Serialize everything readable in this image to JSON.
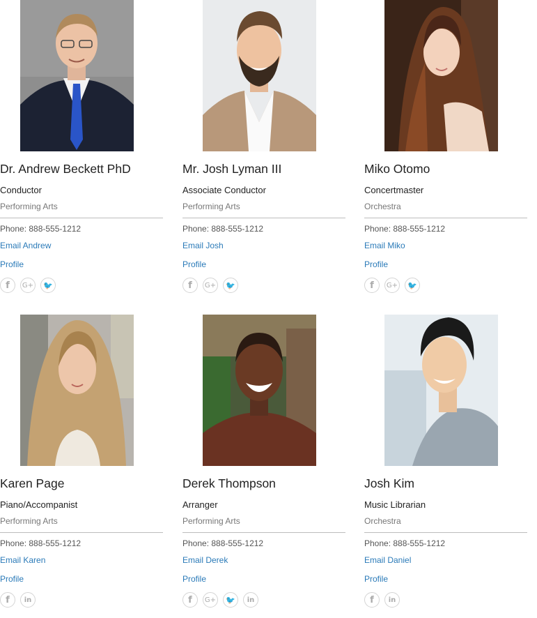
{
  "people": [
    {
      "name": "Dr. Andrew Beckett PhD",
      "title": "Conductor",
      "department": "Performing Arts",
      "phone": "Phone: 888-555-1212",
      "email_label": "Email Andrew",
      "profile_label": "Profile"
    },
    {
      "name": "Mr. Josh Lyman III",
      "title": "Associate Conductor",
      "department": "Performing Arts",
      "phone": "Phone: 888-555-1212",
      "email_label": "Email Josh",
      "profile_label": "Profile"
    },
    {
      "name": "Miko Otomo",
      "title": "Concertmaster",
      "department": "Orchestra",
      "phone": "Phone: 888-555-1212",
      "email_label": "Email Miko",
      "profile_label": "Profile"
    },
    {
      "name": "Karen Page",
      "title": "Piano/Accompanist",
      "department": "Performing Arts",
      "phone": "Phone: 888-555-1212",
      "email_label": "Email Karen",
      "profile_label": "Profile"
    },
    {
      "name": "Derek Thompson",
      "title": "Arranger",
      "department": "Performing Arts",
      "phone": "Phone: 888-555-1212",
      "email_label": "Email Derek",
      "profile_label": "Profile"
    },
    {
      "name": "Josh Kim",
      "title": "Music Librarian",
      "department": "Orchestra",
      "phone": "Phone: 888-555-1212",
      "email_label": "Email Daniel",
      "profile_label": "Profile"
    }
  ],
  "social_glyphs": {
    "facebook": "f",
    "google_plus": "G+",
    "twitter": "🐦",
    "linkedin": "in"
  },
  "colors": {
    "link": "#2a7ab8",
    "divider": "#bdbdbd",
    "muted": "#777777"
  }
}
